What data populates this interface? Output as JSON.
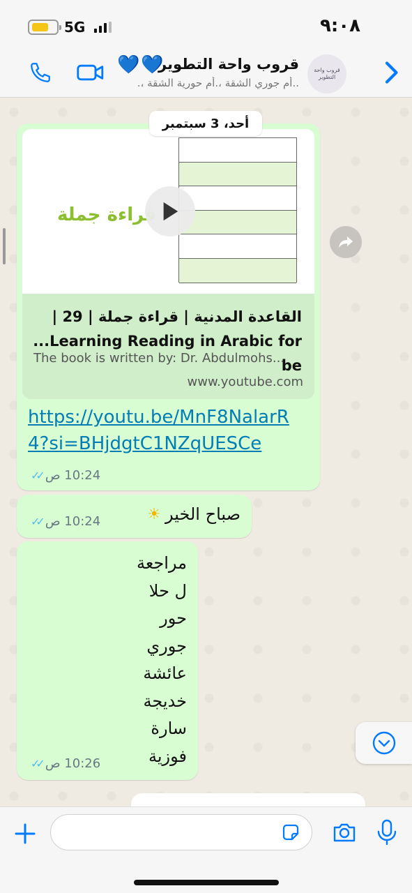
{
  "status": {
    "network": "5G",
    "time": "٩:٠٨",
    "battery_level": 0.7
  },
  "header": {
    "title": "قروب واحة التطوير",
    "hearts": "💙💙",
    "members": "..أم جوري الشقة ،.أم حورية الشقة ،.",
    "avatar_text": "قروب واحة التطوير"
  },
  "chat": {
    "date": "أحد، 3 سبتمبر",
    "link_message": {
      "thumb_label": "قراءة جملة",
      "title_line1": "القاعدة المدنية | قراءة جملة | 29 |",
      "title_line2": "...Learning Reading in Arabic for be",
      "description": "The book is written by: Dr. Abdulmohs...",
      "domain": "www.youtube.com",
      "url": "https://youtu.be/MnF8NalarR4?si=BHjdgtC1NZqUESCe",
      "time": "10:24 ص"
    },
    "greeting_message": {
      "text": "صباح الخير",
      "emoji": "☀",
      "time": "10:24 ص"
    },
    "names_message": {
      "lines": [
        "مراجعة",
        "ل حلا",
        "حور",
        "جوري",
        "عائشة",
        "خديجة",
        "سارة",
        "فوزية"
      ],
      "time": "10:26 ص"
    }
  },
  "input": {
    "placeholder": ""
  },
  "colors": {
    "accent": "#007aff",
    "bubble_outgoing": "#d9fdd3",
    "link": "#027eb5",
    "read_ticks": "#53bdeb"
  }
}
